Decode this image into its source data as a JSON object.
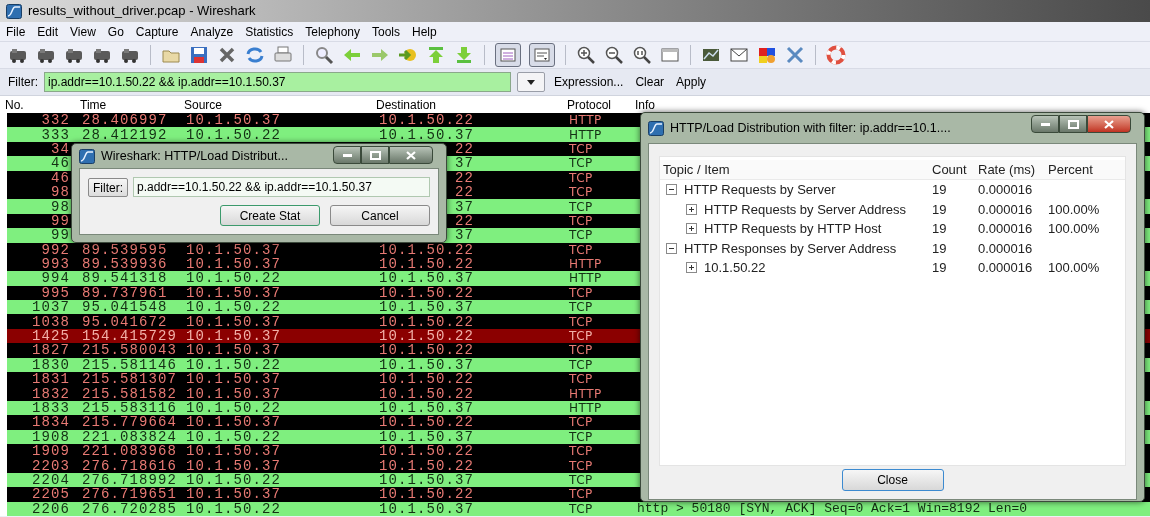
{
  "window": {
    "title": "results_without_driver.pcap - Wireshark"
  },
  "menu": [
    "File",
    "Edit",
    "View",
    "Go",
    "Capture",
    "Analyze",
    "Statistics",
    "Telephony",
    "Tools",
    "Help"
  ],
  "toolbar": {
    "toggles": [
      {
        "pressed": true
      },
      {
        "pressed": true
      }
    ]
  },
  "filter_bar": {
    "label": "Filter:",
    "value": "ip.addr==10.1.50.22 && ip.addr==10.1.50.37",
    "links": [
      "Expression...",
      "Clear",
      "Apply"
    ]
  },
  "packet_list": {
    "columns": [
      "No.",
      "Time",
      "Source",
      "Destination",
      "Protocol",
      "Info"
    ],
    "rows": [
      {
        "no": "332",
        "time": "28.406997",
        "source": "10.1.50.37",
        "destination": "10.1.50.22",
        "protocol": "HTTP",
        "color": "#000000"
      },
      {
        "no": "333",
        "time": "28.412192",
        "source": "10.1.50.22",
        "destination": "10.1.50.37",
        "protocol": "HTTP",
        "color": "#7fef7f"
      },
      {
        "no": "34",
        "destination": "22",
        "protocol": "TCP",
        "color": "#000000"
      },
      {
        "no": "46",
        "destination": "37",
        "protocol": "TCP",
        "color": "#7fef7f"
      },
      {
        "no": "46",
        "destination": "22",
        "protocol": "TCP",
        "color": "#000000"
      },
      {
        "no": "98",
        "destination": "22",
        "protocol": "TCP",
        "color": "#000000"
      },
      {
        "no": "98",
        "destination": "37",
        "protocol": "TCP",
        "color": "#7fef7f"
      },
      {
        "no": "99",
        "destination": "22",
        "protocol": "TCP",
        "color": "#000000"
      },
      {
        "no": "99",
        "destination": "37",
        "protocol": "TCP",
        "color": "#7fef7f"
      },
      {
        "no": "992",
        "time": "89.539595",
        "source": "10.1.50.37",
        "destination": "10.1.50.22",
        "protocol": "TCP",
        "color": "#000000"
      },
      {
        "no": "993",
        "time": "89.539936",
        "source": "10.1.50.37",
        "destination": "10.1.50.22",
        "protocol": "HTTP",
        "color": "#000000"
      },
      {
        "no": "994",
        "time": "89.541318",
        "source": "10.1.50.22",
        "destination": "10.1.50.37",
        "protocol": "HTTP",
        "color": "#7fef7f"
      },
      {
        "no": "995",
        "time": "89.737961",
        "source": "10.1.50.37",
        "destination": "10.1.50.22",
        "protocol": "TCP",
        "color": "#000000"
      },
      {
        "no": "1037",
        "time": "95.041548",
        "source": "10.1.50.22",
        "destination": "10.1.50.37",
        "protocol": "TCP",
        "color": "#7fef7f"
      },
      {
        "no": "1038",
        "time": "95.041672",
        "source": "10.1.50.37",
        "destination": "10.1.50.22",
        "protocol": "TCP",
        "color": "#000000"
      },
      {
        "no": "1425",
        "time": "154.415729",
        "source": "10.1.50.37",
        "destination": "10.1.50.22",
        "protocol": "TCP",
        "color": "#8b0000"
      },
      {
        "no": "1827",
        "time": "215.580043",
        "source": "10.1.50.37",
        "destination": "10.1.50.22",
        "protocol": "TCP",
        "color": "#000000"
      },
      {
        "no": "1830",
        "time": "215.581146",
        "source": "10.1.50.22",
        "destination": "10.1.50.37",
        "protocol": "TCP",
        "color": "#7fef7f"
      },
      {
        "no": "1831",
        "time": "215.581307",
        "source": "10.1.50.37",
        "destination": "10.1.50.22",
        "protocol": "TCP",
        "color": "#000000"
      },
      {
        "no": "1832",
        "time": "215.581582",
        "source": "10.1.50.37",
        "destination": "10.1.50.22",
        "protocol": "HTTP",
        "color": "#000000"
      },
      {
        "no": "1833",
        "time": "215.583116",
        "source": "10.1.50.22",
        "destination": "10.1.50.37",
        "protocol": "HTTP",
        "color": "#7fef7f"
      },
      {
        "no": "1834",
        "time": "215.779664",
        "source": "10.1.50.37",
        "destination": "10.1.50.22",
        "protocol": "TCP",
        "color": "#000000"
      },
      {
        "no": "1908",
        "time": "221.083824",
        "source": "10.1.50.22",
        "destination": "10.1.50.37",
        "protocol": "TCP",
        "color": "#7fef7f"
      },
      {
        "no": "1909",
        "time": "221.083968",
        "source": "10.1.50.37",
        "destination": "10.1.50.22",
        "protocol": "TCP",
        "color": "#000000"
      },
      {
        "no": "2203",
        "time": "276.718616",
        "source": "10.1.50.37",
        "destination": "10.1.50.22",
        "protocol": "TCP",
        "color": "#000000"
      },
      {
        "no": "2204",
        "time": "276.718992",
        "source": "10.1.50.22",
        "destination": "10.1.50.37",
        "protocol": "TCP",
        "color": "#7fef7f"
      },
      {
        "no": "2205",
        "time": "276.719651",
        "source": "10.1.50.37",
        "destination": "10.1.50.22",
        "protocol": "TCP",
        "color": "#000000"
      },
      {
        "no": "2206",
        "time": "276.720285",
        "source": "10.1.50.22",
        "destination": "10.1.50.37",
        "protocol": "TCP",
        "info": "http > 50180 [SYN, ACK] Seq=0 Ack=1 Win=8192 Len=0",
        "color": "#7fef7f"
      }
    ]
  },
  "filter_dialog": {
    "title": "Wireshark: HTTP/Load Distribut...",
    "filter_button": "Filter:",
    "filter_value": "p.addr==10.1.50.22 && ip.addr==10.1.50.37",
    "buttons": [
      "Create Stat",
      "Cancel"
    ]
  },
  "stats_dialog": {
    "title": "HTTP/Load Distribution with filter: ip.addr==10.1....",
    "columns": [
      "Topic / Item",
      "Count",
      "Rate (ms)",
      "Percent"
    ],
    "tree": [
      {
        "topic": "HTTP Requests by Server",
        "count": "19",
        "rate": "0.000016",
        "expanded": true,
        "children": [
          {
            "topic": "HTTP Requests by Server Address",
            "count": "19",
            "rate": "0.000016",
            "percent": "100.00%",
            "expanded": false
          },
          {
            "topic": "HTTP Requests by HTTP Host",
            "count": "19",
            "rate": "0.000016",
            "percent": "100.00%",
            "expanded": false
          }
        ]
      },
      {
        "topic": "HTTP Responses by Server Address",
        "count": "19",
        "rate": "0.000016",
        "expanded": true,
        "children": [
          {
            "topic": "10.1.50.22",
            "count": "19",
            "rate": "0.000016",
            "percent": "100.00%",
            "expanded": false
          }
        ]
      }
    ],
    "close_button": "Close"
  }
}
